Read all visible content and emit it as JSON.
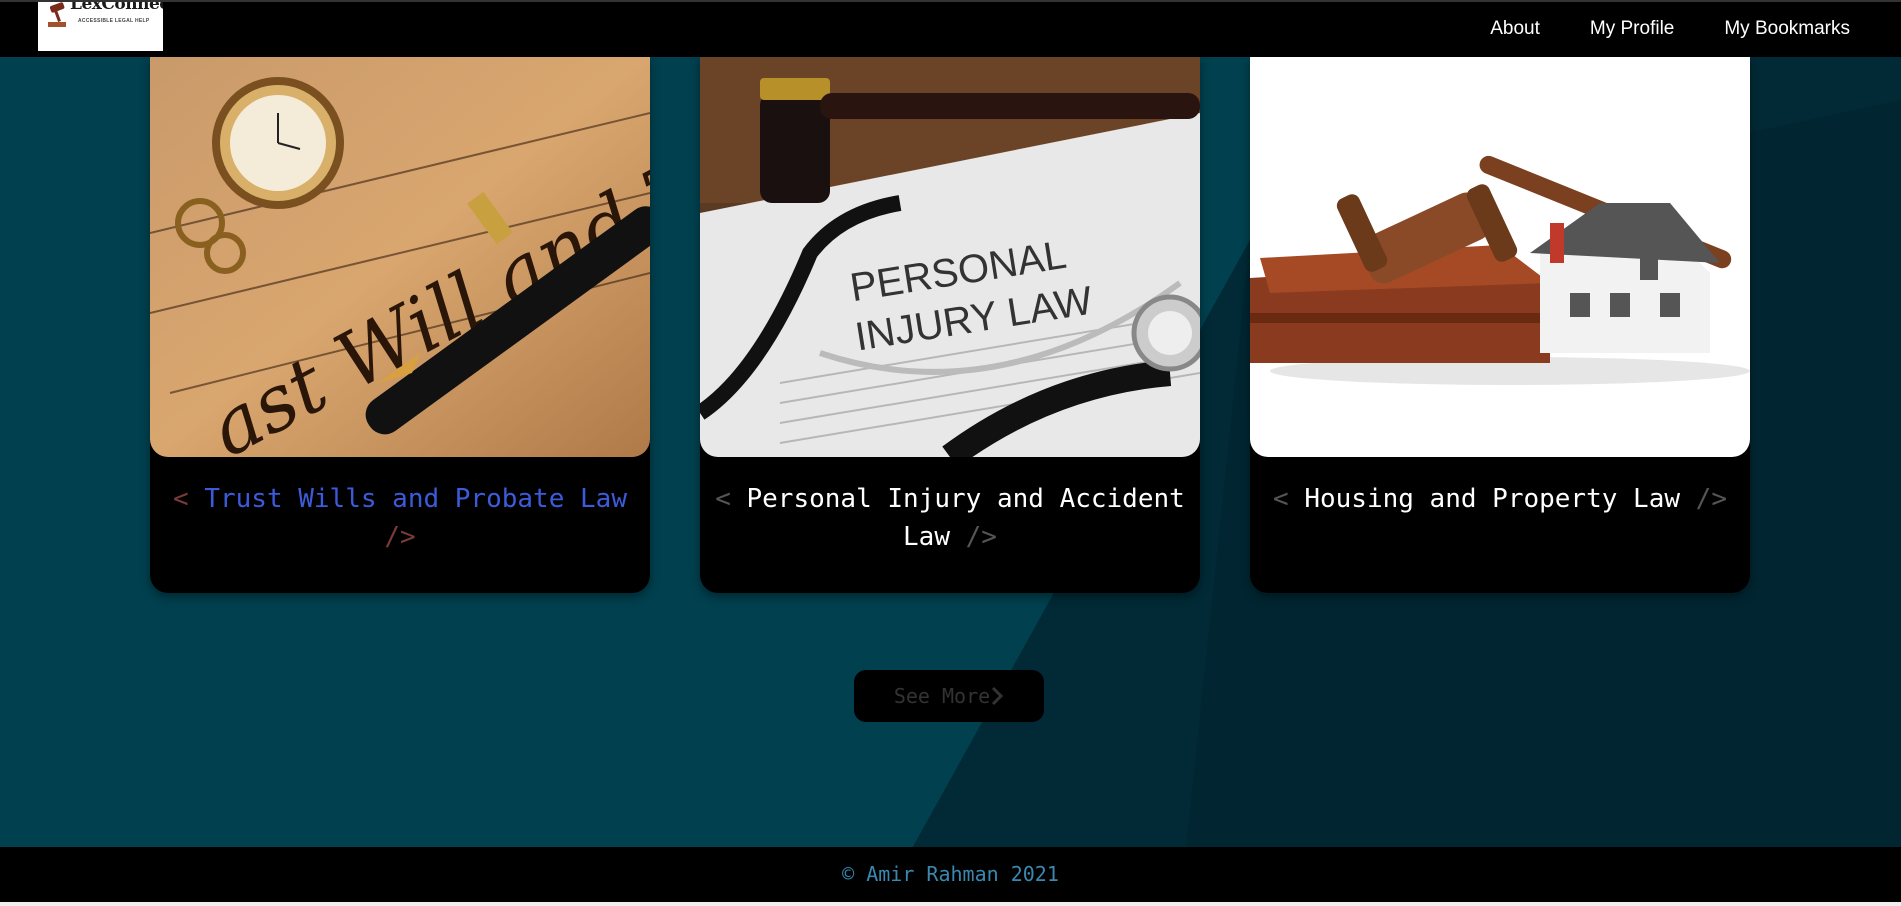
{
  "brand": {
    "name": "LexConnect",
    "tagline": "ACCESSIBLE LEGAL HELP"
  },
  "nav": {
    "items": [
      "About",
      "My Profile",
      "My Bookmarks"
    ]
  },
  "cards": [
    {
      "title": "Trust Wills and Probate Law",
      "open": "<",
      "close": "/>",
      "image": "will-testament-pen-image"
    },
    {
      "title_line1": "Personal Injury and Accident",
      "title_line2": "Law",
      "open": "<",
      "close": "/>",
      "image": "personal-injury-stethoscope-image",
      "photo_text_1": "PERSONAL",
      "photo_text_2": "INJURY LAW"
    },
    {
      "title": "Housing and Property Law",
      "open": "<",
      "close": "/>",
      "image": "gavel-house-image"
    }
  ],
  "see_more": {
    "label": "See More",
    "icon": "chevron-right-icon"
  },
  "footer": {
    "text": "© Amir Rahman 2021"
  },
  "colors": {
    "background": "#012a36",
    "accent": "#3b5bdb",
    "footer_text": "#3a88b0"
  }
}
